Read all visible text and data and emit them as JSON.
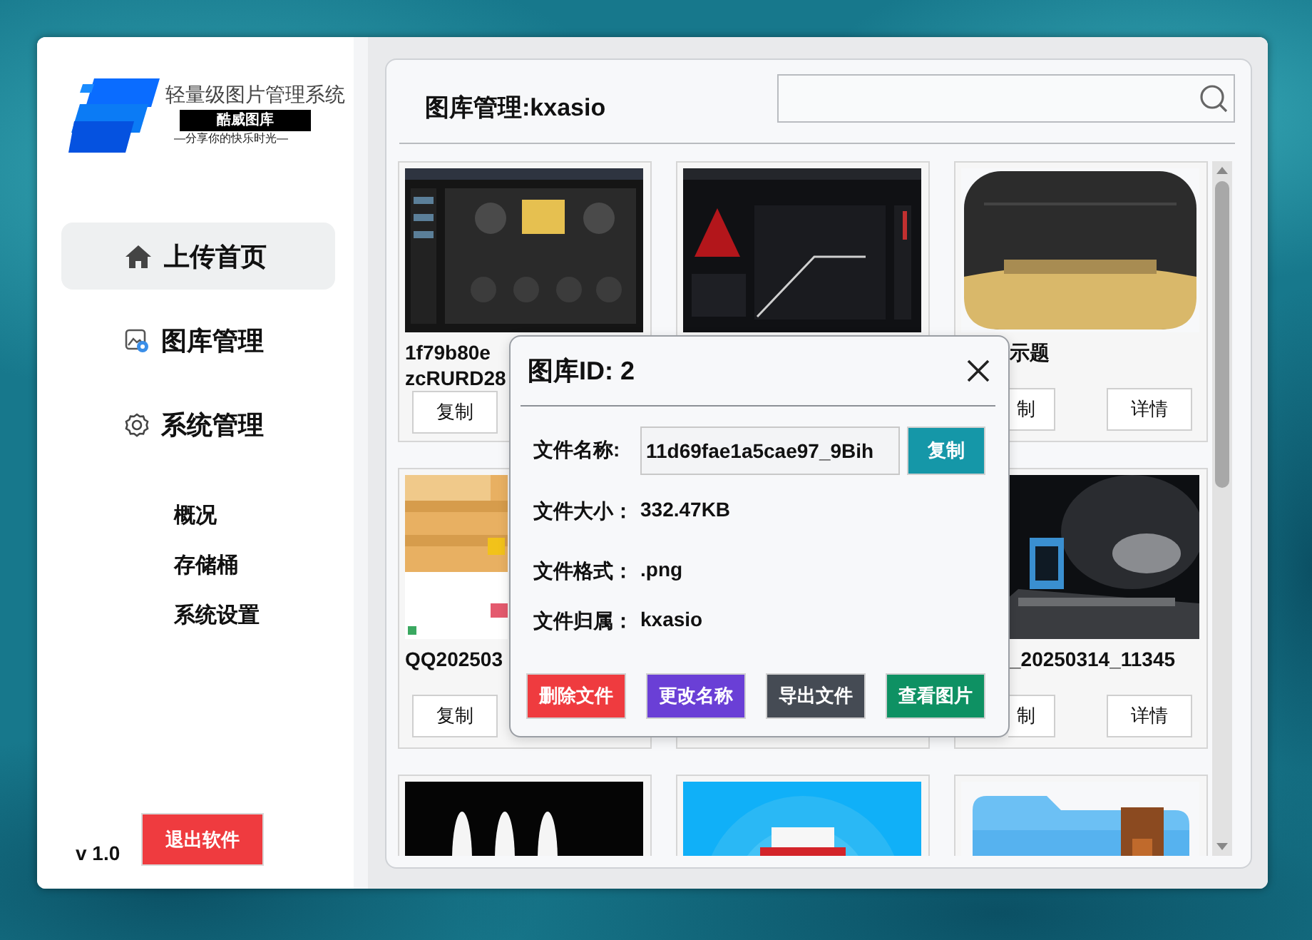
{
  "sidebar": {
    "app_title": "轻量级图片管理系统",
    "brand": "酷威图库",
    "slogan": "—分享你的快乐时光—",
    "nav": [
      {
        "label": "上传首页",
        "selected": true
      },
      {
        "label": "图库管理",
        "selected": false
      },
      {
        "label": "系统管理",
        "selected": false
      }
    ],
    "sub_items": [
      {
        "label": "概况",
        "selected": false
      },
      {
        "label": "存储桶",
        "selected": false
      },
      {
        "label": "系统设置",
        "selected": false
      }
    ],
    "version": "v 1.0",
    "exit_button": "退出软件"
  },
  "gallery": {
    "title": "图库管理:kxasio",
    "cards": [
      {
        "kind": "picture",
        "name_lines": [
          "1f79b80e",
          "zcRURD28"
        ],
        "buttons": [
          "复制"
        ]
      },
      {
        "kind": "picture"
      },
      {
        "kind": "picture",
        "name_lines": [
          "示题"
        ],
        "buttons": [
          "制",
          "详情"
        ]
      },
      {
        "kind": "picture",
        "name_lines": [
          "QQ202503"
        ],
        "buttons": [
          "复制"
        ]
      },
      {
        "kind": "picture"
      },
      {
        "kind": "picture",
        "name_lines": [
          "_20250314_11345"
        ],
        "buttons": [
          "制",
          "详情"
        ]
      },
      {
        "kind": "picture"
      },
      {
        "kind": "picture"
      },
      {
        "kind": "picture"
      }
    ]
  },
  "dialog": {
    "title": "图库ID: 2",
    "name_field": {
      "label": "文件名称:",
      "value": "11d69fae1a5cae97_9Bih",
      "button": "复制"
    },
    "details": [
      {
        "label": "文件大小：",
        "value": "332.47KB"
      },
      {
        "label": "文件格式：",
        "value": ".png"
      },
      {
        "label": "文件归属：",
        "value": "kxasio"
      }
    ],
    "actions": [
      {
        "label": "删除文件",
        "color": "#ef3b3f"
      },
      {
        "label": "更改名称",
        "color": "#6a3fd6"
      },
      {
        "label": "导出文件",
        "color": "#454b54"
      },
      {
        "label": "查看图片",
        "color": "#0e9163"
      }
    ]
  }
}
